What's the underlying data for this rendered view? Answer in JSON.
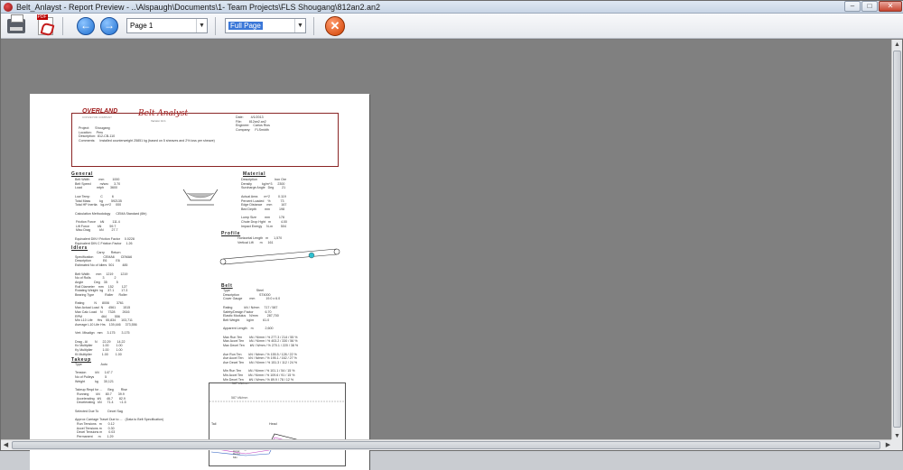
{
  "window": {
    "title": "Belt_Anlayst  - Report Preview - ..\\Alspaugh\\Documents\\1- Team Projects\\FLS Shougang\\812an2.an2"
  },
  "toolbar": {
    "page_select": "Page 1",
    "zoom_select": "Full Page"
  },
  "report": {
    "logo_overland": "OVERLAND",
    "logo_overland_sub": "CONVEYOR COMPANY",
    "logo_belt_analyst": "Belt Analyst",
    "logo_version": "Version 12.1",
    "header_left": "Project:      Shougang\nLocation:     Peru\nDescription:  812-CB-110\nComments:     Installed counterweight 25851 kg (based on 5 sheaves and 2% loss per sheave)",
    "header_right": "Date:        4/1/2013\nFile:        812an2.an2\nEngineer:    Carlos Rios\nCompany:     FLSmidth",
    "general_title": "General",
    "general_body": "Belt Width          mm         1000\nBelt Speed          m/sec      3.70\nLoad                mtph       3600\n\nLow Temp            C          6\nTotal Mass          kg         592135\nTotal HP Inertia    kg-m^2     000\n\nCalculation Methodology      CEMA Standard (6th)\n\n Friction Force     kN         111.4\n Lift Force         kN         59.7\n Misc Drag          kN         27.7\n\nEquivalent DIN f Friction Factor     0.0228\nEquivalent DIN C Friction Factor     1.26",
    "idlers_title": "Idlers",
    "idlers_body": "                        Carry       Return\nSpecification           CEMA6       CEMA6\nDescription             E6          E6\nEstimated No of Idlers  501         485\n\nBelt Width       mm     1219        1219\nNo of Rolls             3           2\nAngle            Deg    35          5\nRoll Diameter    mm     152         127\nRotating Weight  kg     37.1        17.3\nBearing Type            Roller      Roller\n\nRating           N      8006        3761\nMax Actual Load  N      4561        1515\nMax Calc Load    N      7328        2616\nRPM                     464         556\nMin L10 Life     Hrs    55,834      103,711\nAverage L10 Life Hrs    139,446     373,556\n\nVert. Misalign   mm     3.175       3.175\n\nDrag - Ai        N      22.29       14.22\nKx Multiplier           1.00        1.00\nKy Multiplier           1.00        1.00\nKt Multiplier           1.00        1.00",
    "takeup_title": "Takeup",
    "takeup_body": "Type                     Auto\n\nTension          kN      147.7\nNo of Pulleys            5\nWeight           kg      30,121\n\nTakeup Reqd for ...      Beg        Rise\n  Running        kN      80.7       39.9\n  Accelerating   kN      46.7       82.9\n  Decelerating   kN      71.4       <1.5\n\nSelected Due To          Decel Sag\n\nApprox Carriage Travel Due to ...   (Data to Belt Specification)\n  Run Tensions   m       0.12\n  Accel Tensions m       0.30\n  Decel Tensions m       0.03\n  Permanent      m       1.29\n  Total          m       1.89",
    "material_title": "Material",
    "material_body": "Description                   Iron Ore\nDensity           kg/m^3      2300\nSurcharge Angle   Deg         21\n\nActual Area       m^2         0.119\nPercent Loaded    %           73\nEdge Distance     mm          167\nBed Depth         mm          198\n\nLump Size         mm          178\nChute Drop Hght   m           4.00\nImpact Energy     N-m         504",
    "profile_title": "Profile",
    "profile_body": "Horizontal Length   m      1,570\nVertical Lift       m      161",
    "belt_title": "Belt",
    "belt_body": "Type                             Steel\nDescription                      ST4000\nCover Gauge        mm            19.0 x 6.0\n\nRating             kN / N/mm     717 / 587\nSafety/Design Factor             6.70\nElastic Modulus    N/mm          287,700\nBelt Weight        kg/m          61.0\n\nApparent Length    m             2,600\n\nMax Run Ten        kN / N/mm / % 277.3 / 214 / 55 %\nMax Accel Ten      kN / N/mm / % 403.2 / 330 / 56 %\nMax Decel Ten      kN / N/mm / % 270.1 / 220 / 38 %\n\nAve Run Ten        kN / N/mm / % 155.5 / 128 / 22 %\nAve Accel Ten      kN / N/mm / % 195.1 / 162 / 27 %\nAve Decel Ten      kN / N/mm / % 151.3 / 112 / 24 %\n\nMin Run Ten        kN / N/mm / % 101.1 / 54 / 15 %\nMin Accel Ten      kN / N/mm / % 109.6 / 91 / 15 %\nMin Decel Ten      kN / N/mm / % 89.9 / 78 / 12 %",
    "graph_label_top": "587 kN/mm",
    "graph_label_mid": "587 kN/mm",
    "graph_label_tail": "Tail",
    "graph_label_head": "Head",
    "graph_legend": "Run\nAccel\nDecel\nMin"
  }
}
